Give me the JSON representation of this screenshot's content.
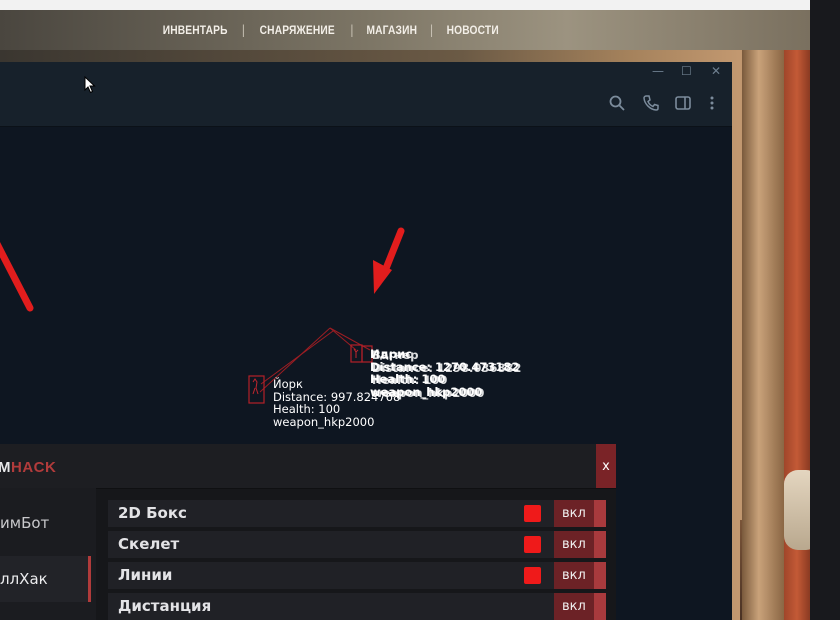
{
  "nav": {
    "items": [
      "ИНВЕНТАРЬ",
      "СНАРЯЖЕНИЕ",
      "МАГАЗИН",
      "НОВОСТИ"
    ]
  },
  "window": {
    "controls": {
      "minimize": "—",
      "maximize": "☐",
      "close": "✕"
    },
    "header_icons": [
      "search-icon",
      "phone-icon",
      "sidebar-toggle-icon",
      "more-vertical-icon"
    ]
  },
  "esp": {
    "players": [
      {
        "name": "Йорк",
        "distance": "Distance: 997.824768",
        "health": "Health: 100",
        "weapon": "weapon_hkp2000"
      },
      {
        "name": "Идрис",
        "distance": "Distance: 1270.473182",
        "health": "Health: 100",
        "weapon": "weapon_hkp2000"
      },
      {
        "name": "Вагнер",
        "distance": "Distance: 1298.036882",
        "health": "Health: 100",
        "weapon": "weapon_hkp2000"
      }
    ]
  },
  "menu": {
    "brand_left": "М",
    "brand_accent": "HACK",
    "close_label": "x",
    "tabs": [
      {
        "label": "имБот",
        "active": false
      },
      {
        "label": "ллХак",
        "active": true
      }
    ],
    "rows": [
      {
        "label": "2D Бокс",
        "checked": true,
        "button": "вкл"
      },
      {
        "label": "Скелет",
        "checked": true,
        "button": "вкл"
      },
      {
        "label": "Линии",
        "checked": true,
        "button": "вкл"
      },
      {
        "label": "Дистанция",
        "checked": false,
        "button": "вкл"
      }
    ]
  },
  "colors": {
    "accent": "#b13b3b",
    "check_red": "#ef1a1a",
    "arrow_red": "#e21d1d",
    "window_bg": "#0e1621",
    "window_header": "#17212b"
  }
}
